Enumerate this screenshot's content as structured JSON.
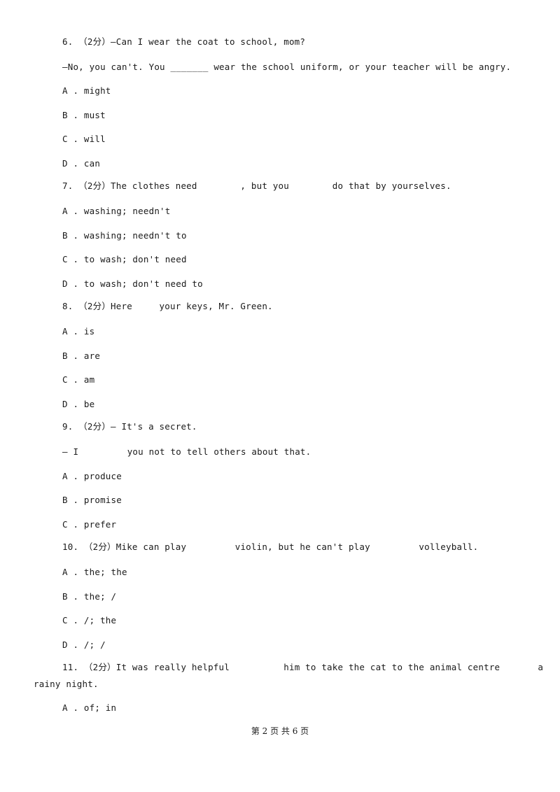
{
  "questions": [
    {
      "number": "6.",
      "points": "（2分）",
      "stem": "—Can I wear the coat to school, mom?",
      "stem2": "—No, you can't. You _______ wear the school uniform, or your teacher will be angry.",
      "options": [
        "A . might",
        "B . must",
        "C . will",
        "D . can"
      ]
    },
    {
      "number": "7.",
      "points": "（2分）",
      "stem": "The clothes need        , but you        do that by yourselves.",
      "options": [
        "A . washing; needn't",
        "B . washing; needn't to",
        "C . to wash; don't need",
        "D . to wash; don't need to"
      ]
    },
    {
      "number": "8.",
      "points": "（2分）",
      "stem": "Here     your keys, Mr. Green.",
      "options": [
        "A . is",
        "B . are",
        "C . am",
        "D . be"
      ]
    },
    {
      "number": "9.",
      "points": "（2分）",
      "stem": "— It's a secret.",
      "stem2": "— I         you not to tell others about that.",
      "options": [
        "A . produce",
        "B . promise",
        "C . prefer"
      ]
    },
    {
      "number": "10.",
      "points": "（2分）",
      "stem": "Mike can play         violin, but he can't play         volleyball.",
      "options": [
        "A . the; the",
        "B . the; /",
        "C . /; the",
        "D . /; /"
      ]
    },
    {
      "number": "11.",
      "points": "（2分）",
      "stem": "It was really helpful          him to take the cat to the animal centre       a",
      "stem2": "rainy night.",
      "options": [
        "A . of; in"
      ]
    }
  ],
  "footer": "第 2 页 共 6 页"
}
